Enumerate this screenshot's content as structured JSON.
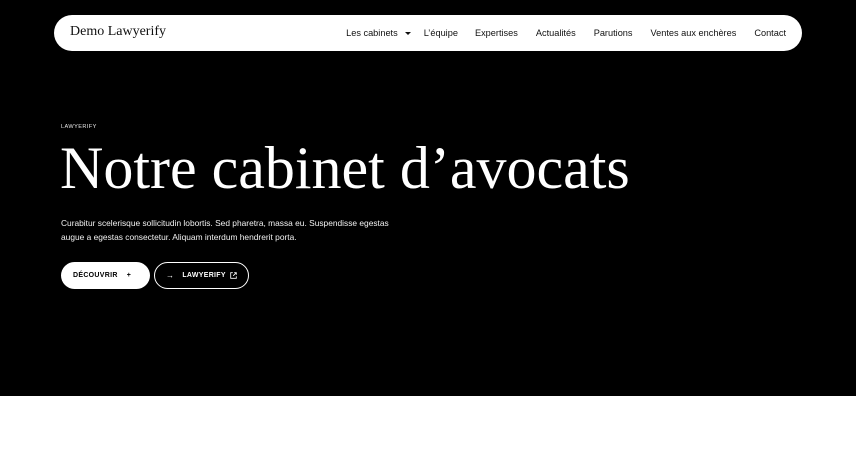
{
  "header": {
    "brand": "Demo Lawyerify",
    "nav": [
      {
        "label": "Les cabinets",
        "has_dropdown": true
      },
      {
        "label": "L’équipe"
      },
      {
        "label": "Expertises"
      },
      {
        "label": "Actualités"
      },
      {
        "label": "Parutions"
      },
      {
        "label": "Ventes aux enchères"
      },
      {
        "label": "Contact"
      }
    ]
  },
  "hero": {
    "eyebrow": "LAWYERIFY",
    "title": "Notre cabinet d’avocats",
    "lead": "Curabitur scelerisque sollicitudin lobortis. Sed pharetra, massa eu. Suspendisse egestas augue a egestas consectetur. Aliquam interdum hendrerit porta.",
    "primary_button": {
      "label": "DÉCOUVRIR",
      "icon": "plus-icon",
      "icon_glyph": "+"
    },
    "secondary_button": {
      "label": "LAWYERIFY",
      "icon": "arrow-right-icon",
      "icon_glyph": "→",
      "trailing_icon": "external-link-icon"
    }
  },
  "colors": {
    "hero_background": "#000000",
    "nav_background": "#ffffff",
    "page_background": "#ffffff"
  }
}
